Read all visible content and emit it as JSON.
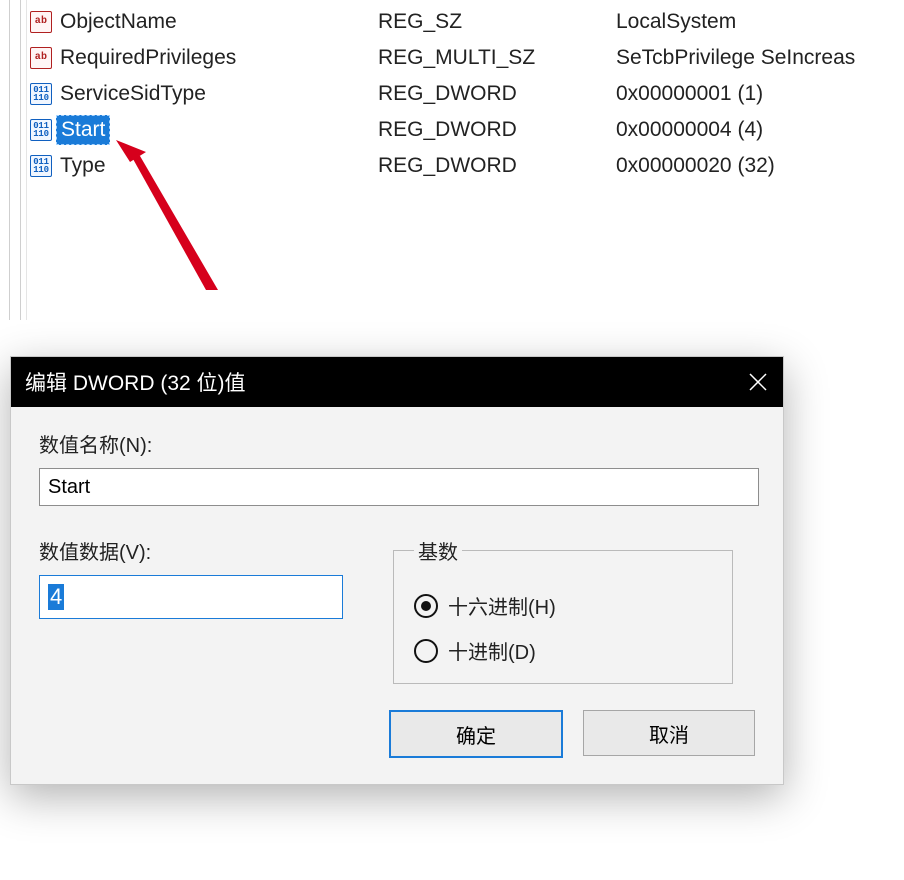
{
  "registry": {
    "columns": [
      "Name",
      "Type",
      "Data"
    ],
    "rows": [
      {
        "icon": "sz",
        "name": "ObjectName",
        "type": "REG_SZ",
        "data": "LocalSystem",
        "selected": false
      },
      {
        "icon": "sz",
        "name": "RequiredPrivileges",
        "type": "REG_MULTI_SZ",
        "data": "SeTcbPrivilege SeIncreas",
        "selected": false
      },
      {
        "icon": "dw",
        "name": "ServiceSidType",
        "type": "REG_DWORD",
        "data": "0x00000001 (1)",
        "selected": false
      },
      {
        "icon": "dw",
        "name": "Start",
        "type": "REG_DWORD",
        "data": "0x00000004 (4)",
        "selected": true
      },
      {
        "icon": "dw",
        "name": "Type",
        "type": "REG_DWORD",
        "data": "0x00000020 (32)",
        "selected": false
      }
    ],
    "icons": {
      "sz_label": "ab",
      "dw_label": "011\n110"
    }
  },
  "dialog": {
    "title": "编辑 DWORD (32 位)值",
    "name_label": "数值名称(N):",
    "name_value": "Start",
    "data_label": "数值数据(V):",
    "data_value": "4",
    "base_legend": "基数",
    "radio_hex": "十六进制(H)",
    "radio_dec": "十进制(D)",
    "base_selected": "hex",
    "ok_label": "确定",
    "cancel_label": "取消"
  }
}
